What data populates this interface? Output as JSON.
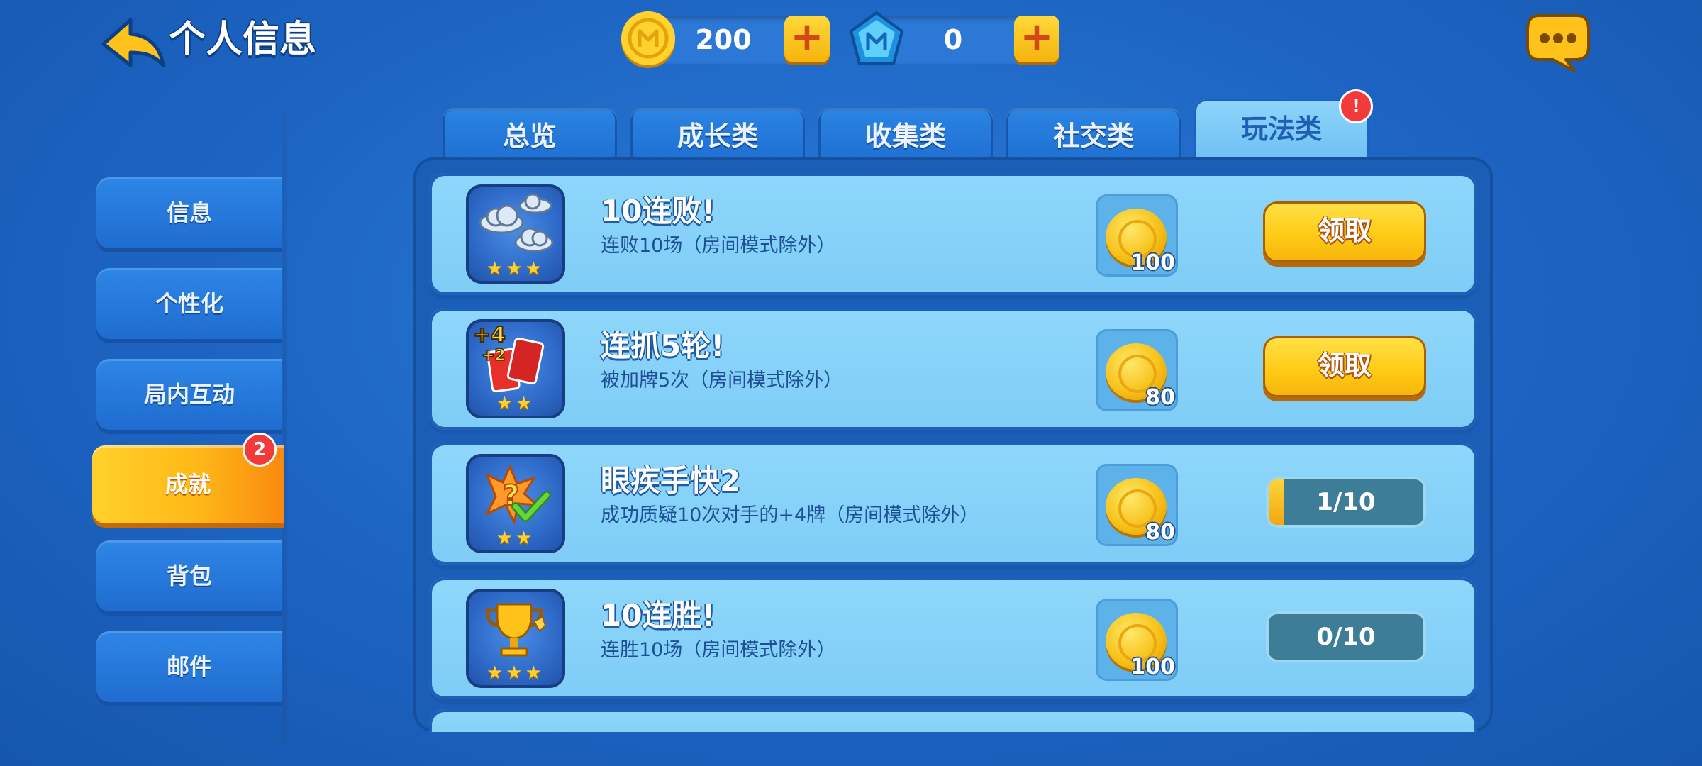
{
  "header": {
    "title": "个人信息",
    "back_icon": "back-arrow-icon",
    "currencies": [
      {
        "name": "coin",
        "icon": "uno-coin-icon",
        "value": "200"
      },
      {
        "name": "gem",
        "icon": "uno-diamond-icon",
        "value": "0"
      }
    ],
    "plus_symbol": "+",
    "chat_icon": "chat-bubble-icon"
  },
  "sidebar": {
    "items": [
      {
        "label": "信息",
        "active": false
      },
      {
        "label": "个性化",
        "active": false
      },
      {
        "label": "局内互动",
        "active": false
      },
      {
        "label": "成就",
        "active": true,
        "badge": "2"
      },
      {
        "label": "背包",
        "active": false
      },
      {
        "label": "邮件",
        "active": false
      }
    ]
  },
  "tabs": [
    {
      "label": "总览",
      "active": false
    },
    {
      "label": "成长类",
      "active": false
    },
    {
      "label": "收集类",
      "active": false
    },
    {
      "label": "社交类",
      "active": false
    },
    {
      "label": "玩法类",
      "active": true,
      "badge": "!"
    }
  ],
  "achievements": [
    {
      "title": "10连败!",
      "desc": "连败10场（房间模式除外）",
      "icon": "clouds-icon",
      "stars": "★★★",
      "reward": "100",
      "action": "claim",
      "button": "领取"
    },
    {
      "title": "连抓5轮!",
      "desc": "被加牌5次（房间模式除外）",
      "icon": "draw-cards-icon",
      "stars": "★★",
      "reward": "80",
      "action": "claim",
      "button": "领取"
    },
    {
      "title": "眼疾手快2",
      "desc": "成功质疑10次对手的+4牌（房间模式除外）",
      "icon": "challenge-icon",
      "stars": "★★",
      "reward": "80",
      "action": "progress",
      "progress": "1/10",
      "progress_value": 0.1
    },
    {
      "title": "10连胜!",
      "desc": "连胜10场（房间模式除外）",
      "icon": "trophy-icon",
      "stars": "★★★",
      "reward": "100",
      "action": "progress",
      "progress": "0/10",
      "progress_value": 0.0
    }
  ],
  "colors": {
    "background": "#1E66C4",
    "card": "#8FD7FB",
    "accent_yellow": "#FFCB16",
    "badge_red": "#F23A3A"
  }
}
